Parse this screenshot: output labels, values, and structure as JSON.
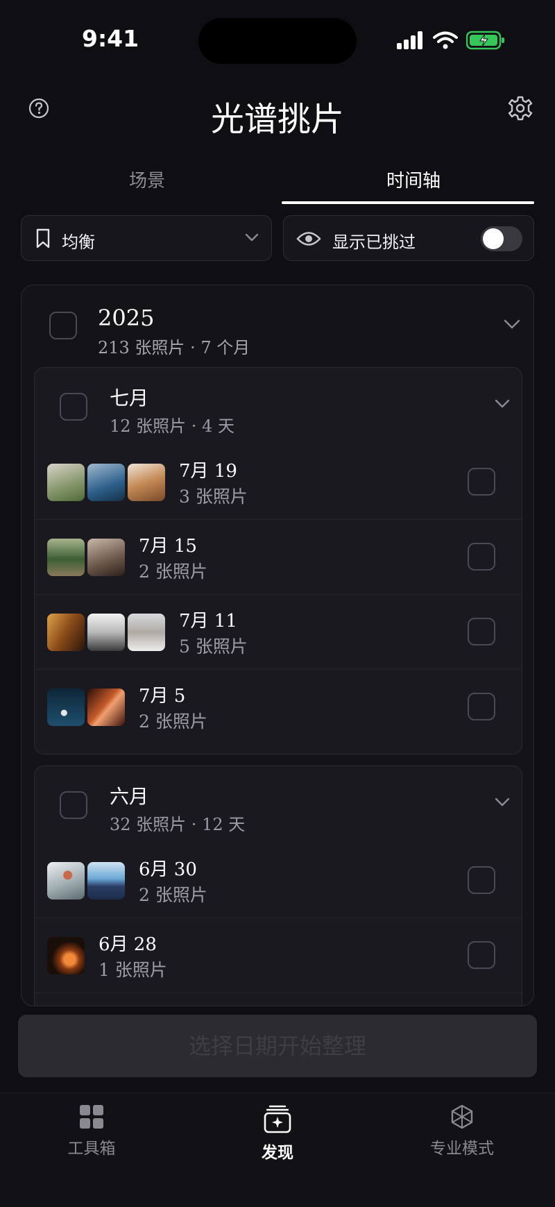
{
  "status": {
    "time": "9:41"
  },
  "header": {
    "title": "光谱挑片"
  },
  "tabs": [
    {
      "label": "场景"
    },
    {
      "label": "时间轴"
    }
  ],
  "filters": {
    "mode_label": "均衡",
    "show_picked_label": "显示已挑过",
    "show_picked_on": false
  },
  "year": {
    "title": "2025",
    "subtitle": "213 张照片 · 7 个月",
    "months": [
      {
        "title": "七月",
        "subtitle": "12 张照片 · 4 天",
        "days": [
          {
            "date": "7月 19",
            "count": "3 张照片",
            "thumbs": [
              [
                "#6f8a55",
                "#d8d3c8"
              ],
              [
                "#2d5f8a",
                "#9fb9cf"
              ],
              [
                "#c48a55",
                "#7a4a2a"
              ]
            ]
          },
          {
            "date": "7月 15",
            "count": "2 张照片",
            "thumbs": [
              [
                "#3b5e35",
                "#a9b48c"
              ],
              [
                "#6a5548",
                "#c9b8aa"
              ]
            ]
          },
          {
            "date": "7月 11",
            "count": "5 张照片",
            "thumbs": [
              [
                "#c98a3a",
                "#3a2410"
              ],
              [
                "#e9e9e9",
                "#5a5a5a"
              ],
              [
                "#d8dade",
                "#7a6f69"
              ]
            ]
          },
          {
            "date": "7月 5",
            "count": "2 张照片",
            "thumbs": [
              [
                "#1f4f6d",
                "#0d2638"
              ],
              [
                "#c45a2a",
                "#2a0e08"
              ]
            ]
          }
        ]
      },
      {
        "title": "六月",
        "subtitle": "32 张照片 · 12 天",
        "days": [
          {
            "date": "6月 30",
            "count": "2 张照片",
            "thumbs": [
              [
                "#dfe3e6",
                "#7b8b8f"
              ],
              [
                "#6aa6d6",
                "#1c2c4a"
              ]
            ]
          },
          {
            "date": "6月 28",
            "count": "1 张照片",
            "thumbs": [
              [
                "#c5571b",
                "#1a0e08"
              ]
            ]
          }
        ]
      }
    ]
  },
  "start_button": "选择日期开始整理",
  "nav": [
    {
      "label": "工具箱",
      "icon": "grid-icon"
    },
    {
      "label": "发现",
      "icon": "discover-icon",
      "active": true
    },
    {
      "label": "专业模式",
      "icon": "cube-icon"
    }
  ],
  "colors": {
    "background": "#0f0e12",
    "battery": "#35c759"
  }
}
